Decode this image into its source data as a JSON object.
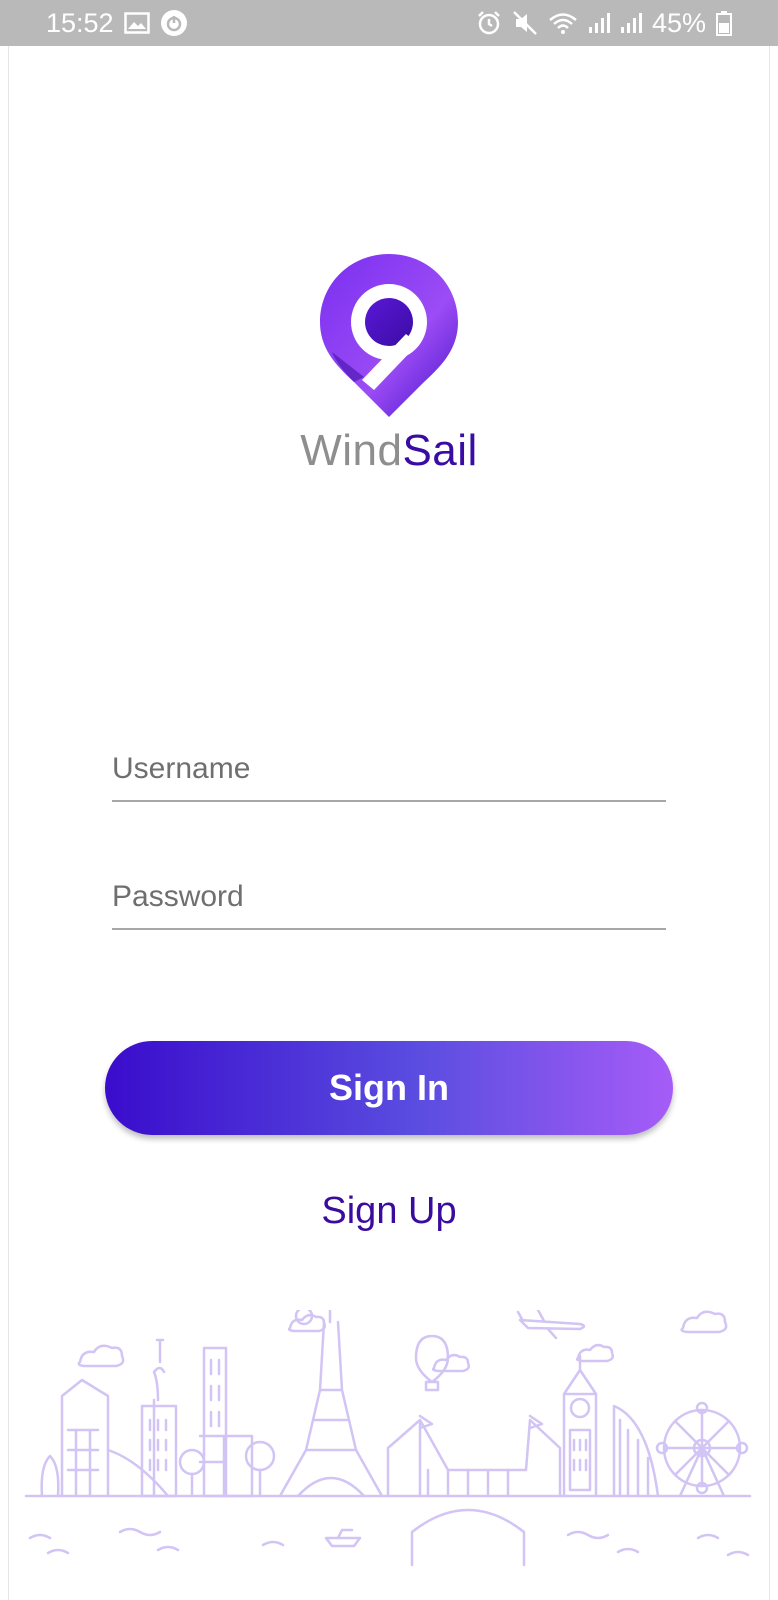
{
  "status_bar": {
    "time": "15:52",
    "battery": "45%",
    "left_icons": [
      "image-icon",
      "power-circle-icon"
    ],
    "right_icons": [
      "alarm-icon",
      "mute-icon",
      "wifi-icon",
      "signal-icon",
      "signal-icon",
      "battery-icon"
    ]
  },
  "logo": {
    "wordmark_part1": "Wind",
    "wordmark_part2": "Sail",
    "mark_icon": "location-pin-logo-icon"
  },
  "form": {
    "username_placeholder": "Username",
    "username_value": "",
    "password_placeholder": "Password",
    "password_value": ""
  },
  "actions": {
    "sign_in_label": "Sign In",
    "sign_up_label": "Sign Up"
  },
  "colors": {
    "brand_dark": "#3a0ca3",
    "brand_light": "#a65cf7",
    "status_bar": "#b9b9b9",
    "skyline_line": "#d5c8f5"
  },
  "illustration": {
    "icon": "city-skyline-illustration"
  }
}
